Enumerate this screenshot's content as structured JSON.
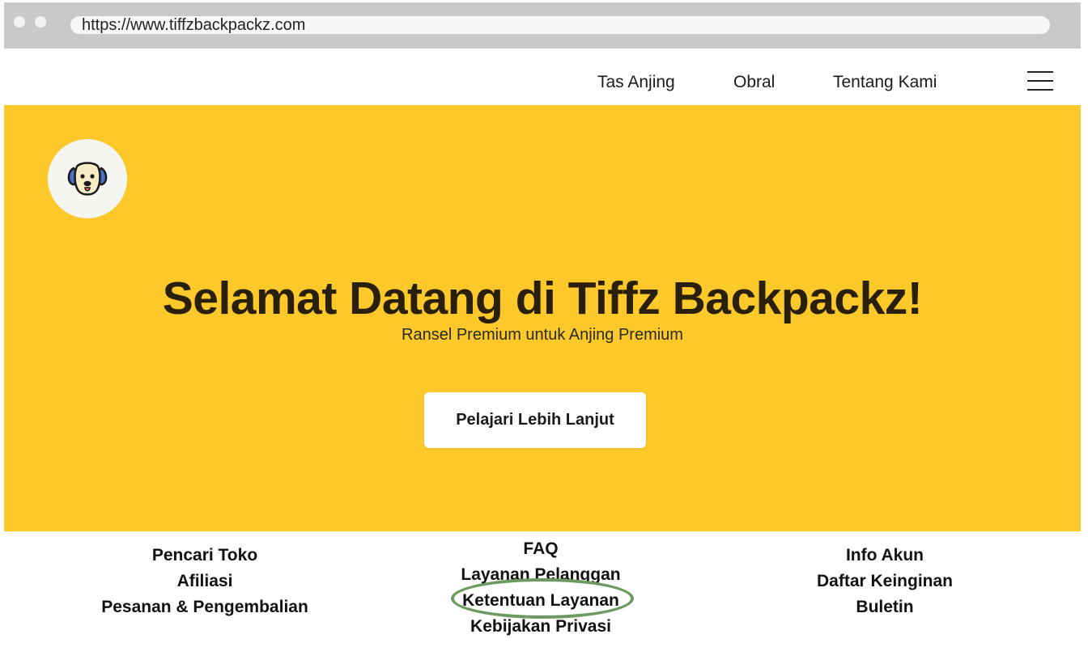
{
  "browser": {
    "url": "https://www.tiffzbackpackz.com"
  },
  "nav": {
    "items": [
      "Tas Anjing",
      "Obral",
      "Tentang Kami"
    ],
    "menu_icon": "hamburger-menu-icon"
  },
  "hero": {
    "logo_icon": "dog-face-icon",
    "title": "Selamat Datang di Tiffz Backpackz!",
    "subtitle": "Ransel Premium untuk Anjing Premium",
    "cta_label": "Pelajari Lebih Lanjut"
  },
  "footer": {
    "col1": [
      "Pencari Toko",
      "Afiliasi",
      "Pesanan & Pengembalian"
    ],
    "col2": [
      "FAQ",
      "Layanan Pelanggan",
      "Ketentuan Layanan",
      "Kebijakan Privasi"
    ],
    "col3": [
      "Info Akun",
      "Daftar Keinginan",
      "Buletin"
    ]
  },
  "colors": {
    "hero_bg": "#fcc82a",
    "chrome_bg": "#c9c9c9",
    "highlight": "#6c9a5e"
  }
}
